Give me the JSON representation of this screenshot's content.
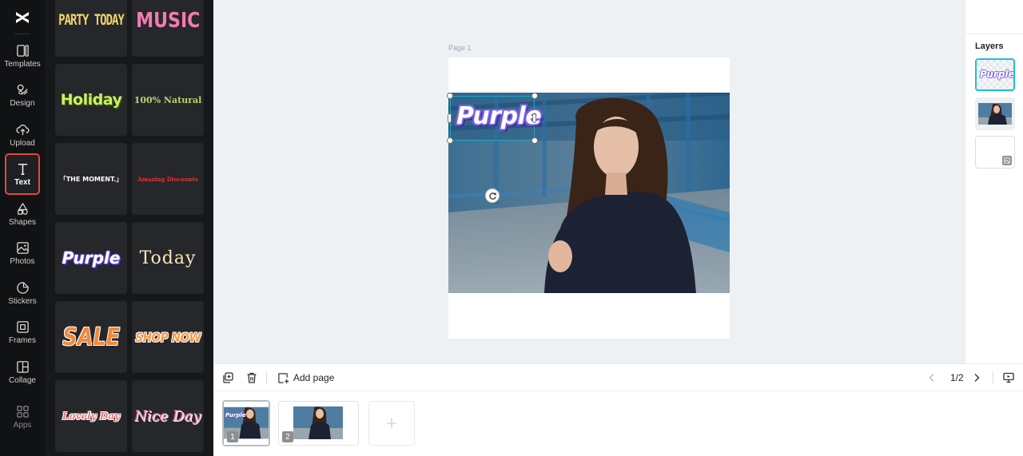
{
  "nav": {
    "items": [
      {
        "label": "Templates",
        "icon": "templates-icon"
      },
      {
        "label": "Design",
        "icon": "design-icon"
      },
      {
        "label": "Upload",
        "icon": "upload-icon"
      },
      {
        "label": "Text",
        "icon": "text-icon",
        "active": true
      },
      {
        "label": "Shapes",
        "icon": "shapes-icon"
      },
      {
        "label": "Photos",
        "icon": "photos-icon"
      },
      {
        "label": "Stickers",
        "icon": "stickers-icon"
      },
      {
        "label": "Frames",
        "icon": "frames-icon"
      },
      {
        "label": "Collage",
        "icon": "collage-icon"
      },
      {
        "label": "Apps",
        "icon": "apps-icon"
      }
    ]
  },
  "text_styles": [
    {
      "text": "PARTY TODAY",
      "color": "#f0d36a"
    },
    {
      "text": "MUSIC",
      "color": "#f27bb2"
    },
    {
      "text": "Holiday",
      "color": "#c9f25e"
    },
    {
      "text": "100% Natural",
      "color": "#b4d66a"
    },
    {
      "text": "「THE MOMENT.」",
      "color": "#ffffff"
    },
    {
      "text": "Amazing Discounts",
      "color": "#e8332d"
    },
    {
      "text": "Purple",
      "color": "#ffffff"
    },
    {
      "text": "Today",
      "color": "#f7e9b0"
    },
    {
      "text": "SALE",
      "color": "#f08a3c"
    },
    {
      "text": "SHOP NOW",
      "color": "#f59a45"
    },
    {
      "text": "Lovely Day",
      "color": "#f07a82"
    },
    {
      "text": "Nice Day",
      "color": "#f4b9c6"
    }
  ],
  "canvas": {
    "page_label": "Page 1",
    "selected_text": "Purple"
  },
  "layers": {
    "title": "Layers",
    "items": [
      {
        "label": "Purple",
        "type": "text"
      },
      {
        "label": "",
        "type": "image"
      },
      {
        "label": "",
        "type": "background"
      }
    ]
  },
  "toolbar": {
    "add_page": "Add page",
    "pager": "1/2"
  },
  "thumbnails": [
    {
      "number": "1",
      "active": true
    },
    {
      "number": "2",
      "active": false
    }
  ],
  "colors": {
    "nav_bg": "#111214",
    "panel_bg": "#171819",
    "active_outline": "#e5473c",
    "selection": "#1aa8c9",
    "canvas_bg": "#eef1f4"
  }
}
